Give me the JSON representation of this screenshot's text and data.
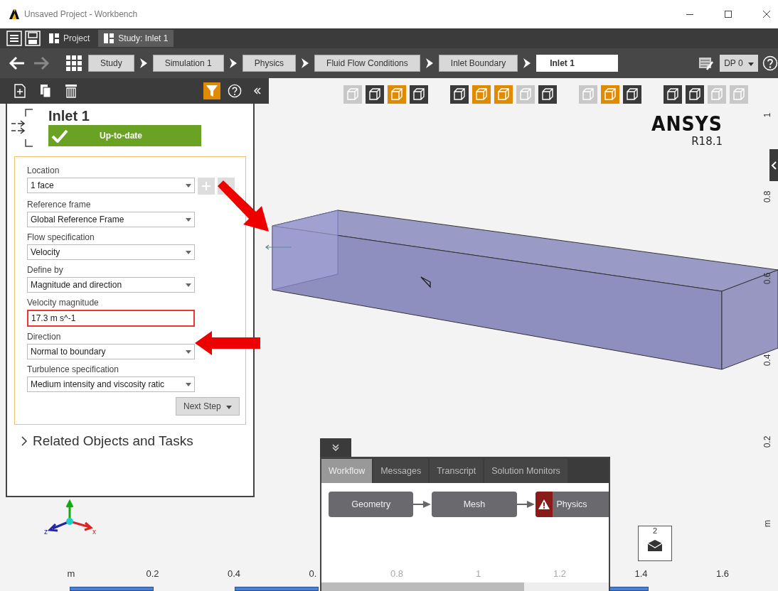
{
  "window": {
    "title": "Unsaved Project - Workbench"
  },
  "tabs": [
    {
      "label": "Project",
      "selected": false
    },
    {
      "label": "Study: Inlet 1",
      "selected": true
    }
  ],
  "breadcrumbs": [
    {
      "label": "Study",
      "current": false
    },
    {
      "label": "Simulation 1",
      "current": false
    },
    {
      "label": "Physics",
      "current": false
    },
    {
      "label": "Fluid Flow Conditions",
      "current": false
    },
    {
      "label": "Inlet Boundary",
      "current": false
    },
    {
      "label": "Inlet 1",
      "current": true
    }
  ],
  "design_point": "DP 0",
  "panel": {
    "title": "Inlet 1",
    "status": "Up-to-date",
    "fields": [
      {
        "kind": "location",
        "label": "Location",
        "value": "1 face",
        "highlighted": false
      },
      {
        "kind": "dropdown",
        "label": "Reference frame",
        "value": "Global Reference Frame",
        "highlighted": false
      },
      {
        "kind": "dropdown",
        "label": "Flow specification",
        "value": "Velocity",
        "highlighted": false
      },
      {
        "kind": "dropdown",
        "label": "Define by",
        "value": "Magnitude and direction",
        "highlighted": false
      },
      {
        "kind": "input",
        "label": "Velocity magnitude",
        "value": "17.3 m s^-1",
        "highlighted": true
      },
      {
        "kind": "dropdown",
        "label": "Direction",
        "value": "Normal to boundary",
        "highlighted": false
      },
      {
        "kind": "dropdown",
        "label": "Turbulence specification",
        "value": "Medium intensity and viscosity ratic",
        "highlighted": false
      }
    ],
    "next_button": "Next Step",
    "related": "Related Objects and Tasks"
  },
  "viewport_tools": [
    [
      {
        "active": false,
        "disabled": true
      },
      {
        "active": false,
        "disabled": false
      },
      {
        "active": true,
        "disabled": false
      },
      {
        "active": false,
        "disabled": false
      }
    ],
    [
      {
        "active": false,
        "disabled": false
      },
      {
        "active": true,
        "disabled": false
      },
      {
        "active": true,
        "disabled": false
      },
      {
        "active": false,
        "disabled": true
      },
      {
        "active": false,
        "disabled": false
      }
    ],
    [
      {
        "active": false,
        "disabled": true
      },
      {
        "active": true,
        "disabled": false
      },
      {
        "active": false,
        "disabled": false
      }
    ],
    [
      {
        "active": false,
        "disabled": false
      },
      {
        "active": false,
        "disabled": false
      },
      {
        "active": false,
        "disabled": true
      },
      {
        "active": false,
        "disabled": true
      }
    ]
  ],
  "viewport": {
    "logo": "ANSYS",
    "version": "R18.1",
    "axes": [
      "z",
      "x"
    ],
    "vertical_scale": [
      "1",
      "0.8",
      "0.6",
      "0.4",
      "0.2",
      "m"
    ],
    "horizontal_scale": [
      {
        "label": "m",
        "covered": false
      },
      {
        "label": "0.2",
        "covered": false
      },
      {
        "label": "0.4",
        "covered": false
      },
      {
        "label": "0.",
        "covered": false
      },
      {
        "label": "0.8",
        "covered": true
      },
      {
        "label": "1",
        "covered": true
      },
      {
        "label": "1.2",
        "covered": true
      },
      {
        "label": "1.4",
        "covered": false
      },
      {
        "label": "1.6",
        "covered": false
      }
    ],
    "notification_count": "2"
  },
  "workflow_panel": {
    "tabs": [
      {
        "label": "Workflow",
        "selected": true
      },
      {
        "label": "Messages",
        "selected": false
      },
      {
        "label": "Transcript",
        "selected": false
      },
      {
        "label": "Solution Monitors",
        "selected": false
      }
    ],
    "steps": [
      {
        "label": "Geometry",
        "warning": false
      },
      {
        "label": "Mesh",
        "warning": false
      },
      {
        "label": "Physics",
        "warning": true
      }
    ]
  }
}
